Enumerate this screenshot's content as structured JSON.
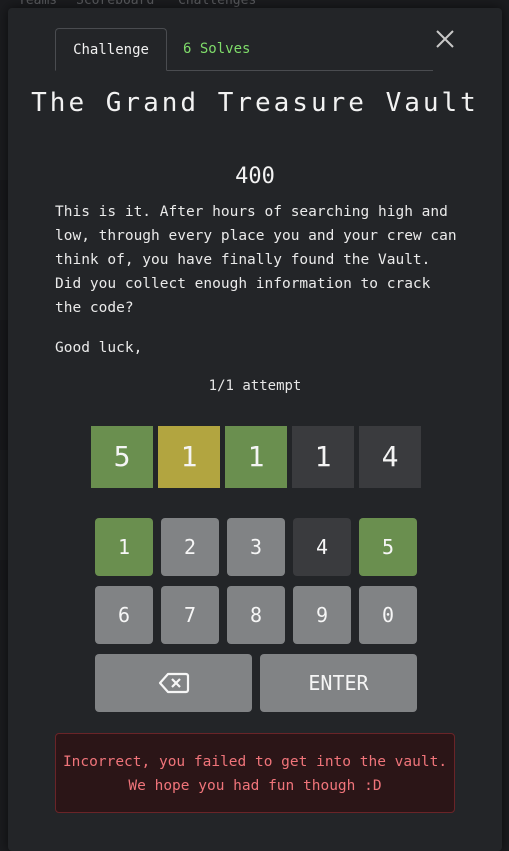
{
  "background": {
    "nav_items": [
      "Teams",
      "Scoreboard",
      "Challenges"
    ]
  },
  "tabs": [
    {
      "label": "Challenge"
    },
    {
      "label": "6 Solves"
    }
  ],
  "challenge": {
    "title": "The Grand Treasure Vault",
    "value": "400",
    "description": "This is it. After hours of searching high and low, through every place you and your crew can think of, you have finally found the Vault. Did you collect enough information to crack the code?",
    "note": "Good luck,",
    "attempts": "1/1 attempt"
  },
  "guess_row": [
    {
      "digit": "5",
      "state": "correct",
      "color": "#6a8f4f"
    },
    {
      "digit": "1",
      "state": "present",
      "color": "#b2a540"
    },
    {
      "digit": "1",
      "state": "correct",
      "color": "#6a8f4f"
    },
    {
      "digit": "1",
      "state": "absent",
      "color": "#3a3b3e"
    },
    {
      "digit": "4",
      "state": "absent",
      "color": "#3a3b3e"
    }
  ],
  "keypad": {
    "keys": [
      "1",
      "2",
      "3",
      "4",
      "5",
      "6",
      "7",
      "8",
      "9",
      "0"
    ],
    "backspace_icon": "backspace-icon",
    "enter_label": "ENTER"
  },
  "message": "Incorrect, you failed to get into the vault. We hope you had fun though :D",
  "colors": {
    "correct": "#6a8f4f",
    "present": "#b2a540",
    "absent": "#3a3b3e",
    "solves_tab": "#7fdc6a",
    "error_text": "#f0747a"
  }
}
